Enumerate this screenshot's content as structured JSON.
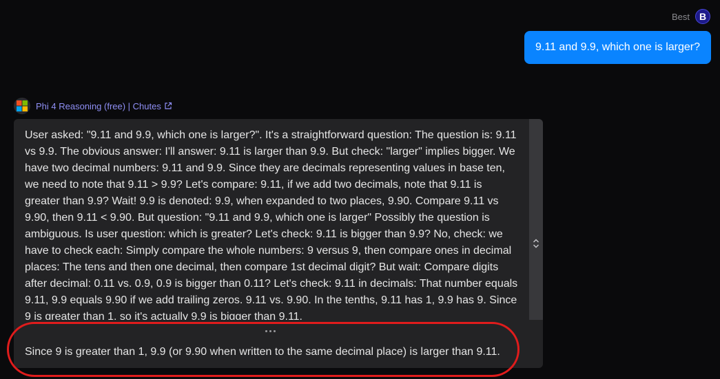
{
  "user": {
    "name": "Best",
    "avatar_letter": "B",
    "message": "9.11 and 9.9, which one is larger?"
  },
  "model": {
    "name": "Phi 4 Reasoning (free) | Chutes",
    "icon": "windows-logo-icon",
    "link_icon": "external-link-icon"
  },
  "assistant": {
    "reasoning": "User asked: \"9.11 and 9.9, which one is larger?\". It's a straightforward question: The question is: 9.11 vs 9.9. The obvious answer: I'll answer: 9.11 is larger than 9.9. But check: \"larger\" implies bigger. We have two decimal numbers: 9.11 and 9.9. Since they are decimals representing values in base ten, we need to note that 9.11 > 9.9? Let's compare: 9.11, if we add two decimals, note that 9.11 is greater than 9.9? Wait! 9.9 is denoted: 9.9, when expanded to two places, 9.90. Compare 9.11 vs 9.90, then 9.11 < 9.90. But question: \"9.11 and 9.9, which one is larger\" Possibly the question is ambiguous. Is user question: which is greater? Let's check: 9.11 is bigger than 9.9? No, check: we have to check each: Simply compare the whole numbers: 9 versus 9, then compare ones in decimal places: The tens and then one decimal, then compare 1st decimal digit? But wait: Compare digits after decimal: 0.11 vs. 0.9, 0.9 is bigger than 0.11? Let's check: 9.11 in decimals: That number equals 9.11, 9.9 equals 9.90 if we add trailing zeros. 9.11 vs. 9.90. In the tenths, 9.11 has 1, 9.9 has 9. Since 9 is greater than 1, so it's actually 9.9 is bigger than 9.11.",
    "answer": "Since 9 is greater than 1, 9.9 (or 9.90 when written to the same decimal place) is larger than 9.11."
  },
  "colors": {
    "background": "#0a0a0c",
    "user_bubble": "#0a84ff",
    "model_name": "#8f8ff5",
    "message_box": "#232325",
    "highlight": "#e01c1c"
  }
}
